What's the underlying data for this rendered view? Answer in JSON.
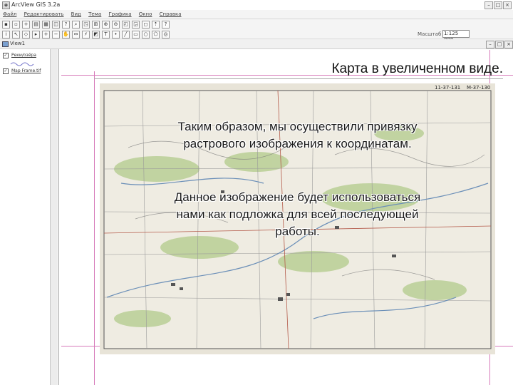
{
  "window": {
    "title": "ArcView GIS 3.2a"
  },
  "menu": [
    "Файл",
    "Редактировать",
    "Вид",
    "Тема",
    "Графика",
    "Окно",
    "Справка"
  ],
  "toolbar": {
    "scale_label": "Масштаб 1:",
    "scale_value": "1:125 000"
  },
  "view": {
    "title": "View1"
  },
  "legend": {
    "items": [
      {
        "label": "Реки/озёра"
      },
      {
        "label": "Map Frame.tif"
      }
    ]
  },
  "map": {
    "sheet_number": "M-37-130",
    "header_code": "11-37-131"
  },
  "slide": {
    "heading": "Карта в увеличенном виде.",
    "paragraph1_line1": "Таким образом, мы осуществили привязку",
    "paragraph1_line2": "растрового изображения к координатам.",
    "paragraph2_line1": "Данное изображение будет использоваться",
    "paragraph2_line2": "нами как подложка для всей последующей",
    "paragraph2_line3": "работы."
  },
  "colors": {
    "guide_lines": "#d77aba",
    "map_paper": "#e8e4d8",
    "map_vegetation": "#b9cf95",
    "window_chrome": "#f4f4f4"
  }
}
